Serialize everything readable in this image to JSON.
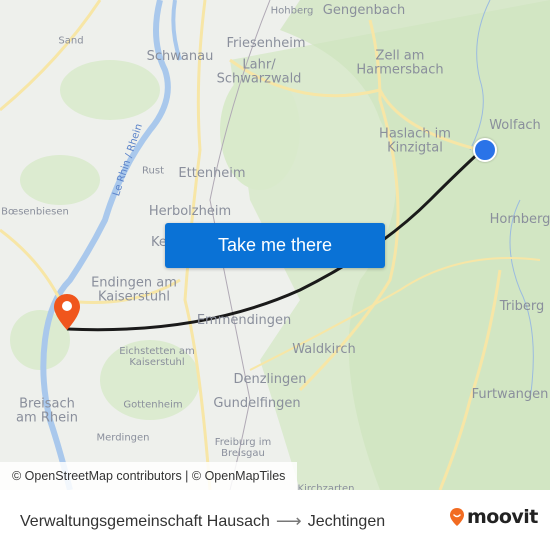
{
  "map": {
    "labels": {
      "sand": "Sand",
      "schwanau": "Schwanau",
      "hohberg": "Hohberg",
      "gengenbach": "Gengenbach",
      "friesenheim": "Friesenheim",
      "lahr": "Lahr/\nSchwarzwald",
      "zell": "Zell am\nHarmersbach",
      "wolfach": "Wolfach",
      "haslach": "Haslach im\nKinzigtal",
      "rhein": "Le Rhin / Rhein",
      "rust": "Rust",
      "ettenheim": "Ettenheim",
      "boesenbiesen": "Bœsenbiesen",
      "herbolzheim": "Herbolzheim",
      "kenzingen": "Ke",
      "hornberg": "Hornberg",
      "endingen": "Endingen am\nKaiserstuhl",
      "emmendingen": "Emmendingen",
      "triberg": "Triberg",
      "eichstetten": "Eichstetten am\nKaiserstuhl",
      "waldkirch": "Waldkirch",
      "denzlingen": "Denzlingen",
      "breisach": "Breisach\nam Rhein",
      "gottenheim": "Gottenheim",
      "gundelfingen": "Gundelfingen",
      "furtwangen": "Furtwangen",
      "merdingen": "Merdingen",
      "freiburg": "Freiburg im\nBreisgau",
      "kirchzarten": "Kirchzarten"
    },
    "cta_label": "Take me there",
    "attribution": "© OpenStreetMap contributors | © OpenMapTiles",
    "route_color": "#1a1a1a",
    "origin_color": "#2a73e8",
    "destination_color": "#f0561d"
  },
  "footer": {
    "origin": "Verwaltungsgemeinschaft Hausach",
    "arrow": "⟶",
    "destination": "Jechtingen",
    "brand": "moovit",
    "brand_color": "#f26b21"
  }
}
